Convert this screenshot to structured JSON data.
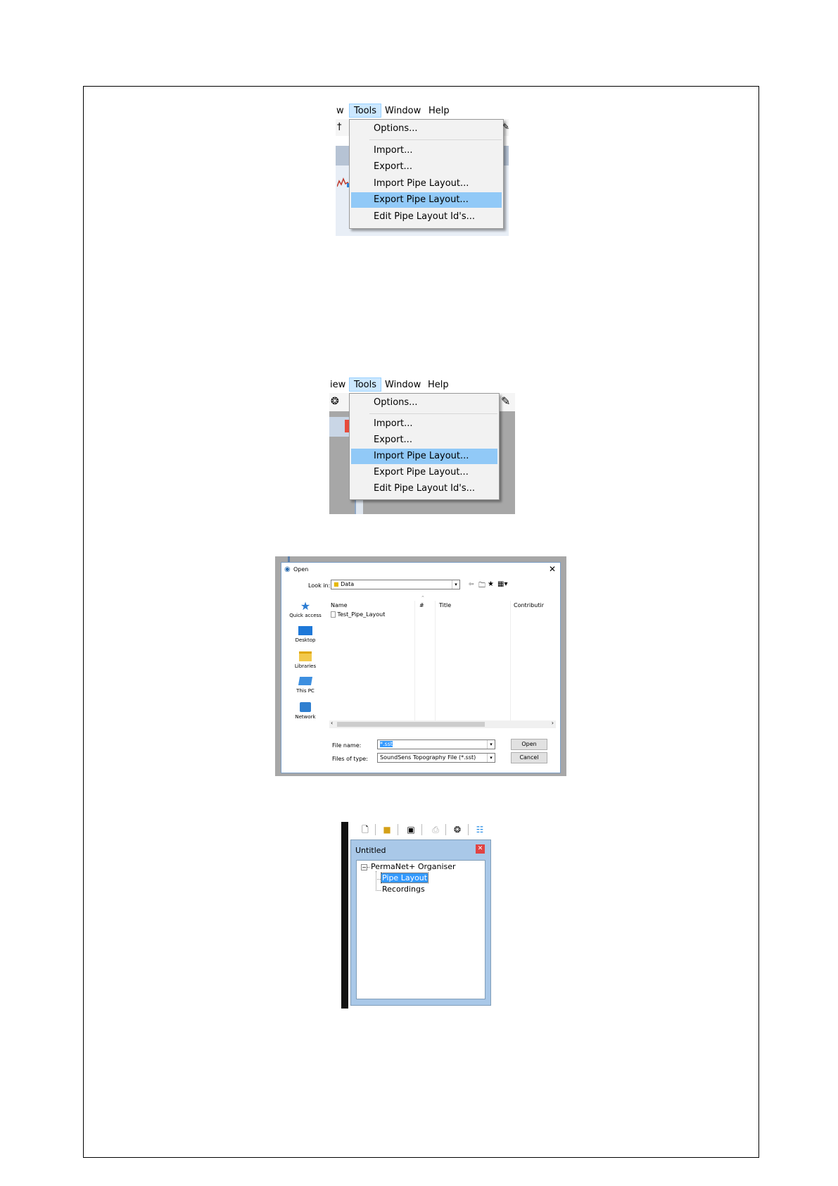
{
  "menu1": {
    "bar": {
      "partial": "w",
      "tools": "Tools",
      "window": "Window",
      "help": "Help"
    },
    "items": [
      "Options...",
      "Import...",
      "Export...",
      "Import Pipe Layout...",
      "Export Pipe Layout...",
      "Edit Pipe Layout Id's..."
    ],
    "highlighted": "Export Pipe Layout..."
  },
  "menu2": {
    "bar": {
      "partial": "iew",
      "tools": "Tools",
      "window": "Window",
      "help": "Help"
    },
    "items": [
      "Options...",
      "Import...",
      "Export...",
      "Import Pipe Layout...",
      "Export Pipe Layout...",
      "Edit Pipe Layout Id's..."
    ],
    "highlighted": "Import Pipe Layout..."
  },
  "open_dialog": {
    "title": "Open",
    "look_in_label": "Look in:",
    "look_in_value": "Data",
    "places": [
      "Quick access",
      "Desktop",
      "Libraries",
      "This PC",
      "Network"
    ],
    "columns": [
      "Name",
      "#",
      "Title",
      "Contributir"
    ],
    "files": [
      "Test_Pipe_Layout"
    ],
    "file_name_label": "File name:",
    "file_name_value": "*.sst",
    "file_type_label": "Files of type:",
    "file_type_value": "SoundSens Topography File (*.sst)",
    "open_button": "Open",
    "cancel_button": "Cancel"
  },
  "tree_window": {
    "title": "Untitled",
    "root": "PermaNet+ Organiser",
    "root_toggle": "−",
    "children": [
      "Pipe Layout",
      "Recordings"
    ],
    "selected": "Pipe Layout"
  },
  "colors": {
    "highlight": "#91c9f7",
    "tree_select": "#3399ff",
    "window_blue": "#a9c8e8"
  }
}
